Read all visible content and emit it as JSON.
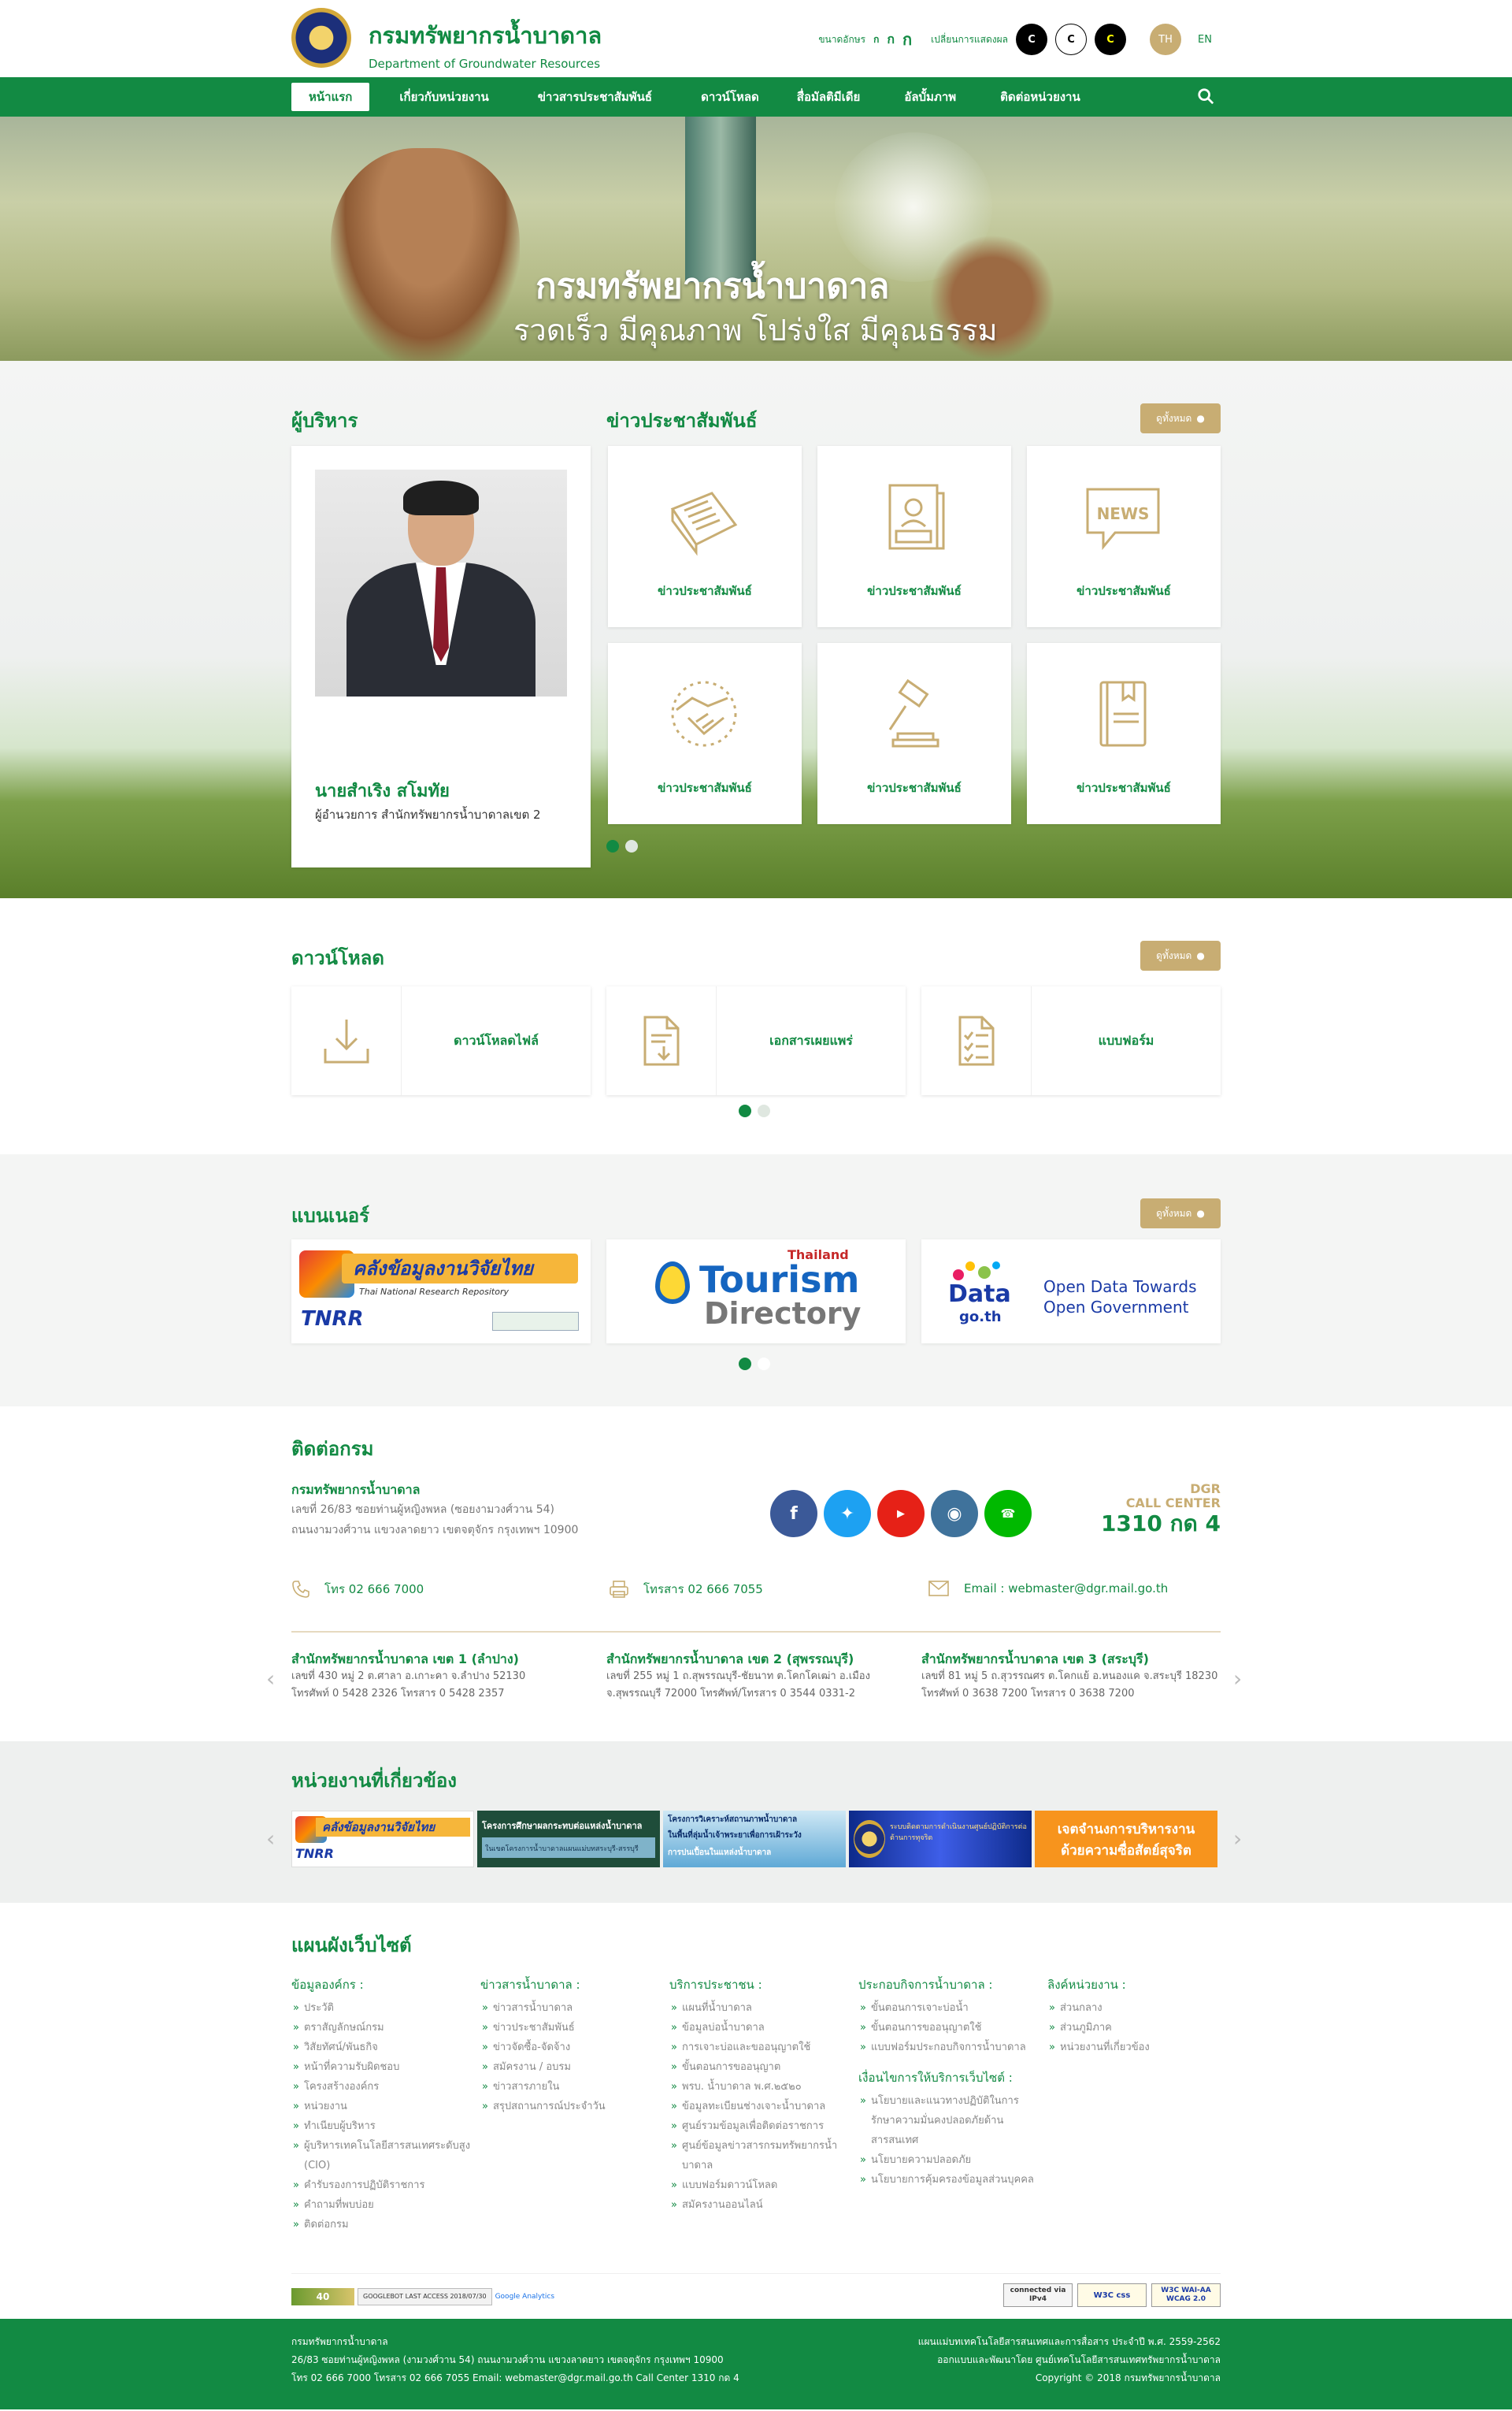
{
  "header": {
    "title_th": "กรมทรัพยากรน้ำบาดาล",
    "title_en": "Department of Groundwater Resources",
    "font_size_label": "ขนาดอักษร",
    "font_sizes": [
      "ก",
      "ก",
      "ก"
    ],
    "contrast_label": "เปลี่ยนการแสดงผล",
    "contrast_options": [
      "C",
      "C",
      "C"
    ],
    "lang_th": "TH",
    "lang_en": "EN"
  },
  "nav": {
    "items": [
      "หน้าแรก",
      "เกี่ยวกับหน่วยงาน",
      "ข่าวสารประชาสัมพันธ์",
      "ดาวน์โหลด",
      "สื่อมัลติมีเดีย",
      "อัลบั้มภาพ",
      "ติดต่อหน่วยงาน"
    ],
    "active_index": 0
  },
  "hero": {
    "title": "กรมทรัพยากรน้ำบาดาล",
    "slogan": "รวดเร็ว มีคุณภาพ โปร่งใส มีคุณธรรม"
  },
  "executives": {
    "heading": "ผู้บริหาร",
    "name": "นายสำเริง สโมทัย",
    "position": "ผู้อำนวยการ สำนักทรัพยากรน้ำบาดาลเขต 2"
  },
  "news": {
    "heading": "ข่าวประชาสัมพันธ์",
    "more_label": "ดูทั้งหมด",
    "cards": [
      {
        "label": "ข่าวประชาสัมพันธ์",
        "icon": "newspaper-icon"
      },
      {
        "label": "ข่าวประชาสัมพันธ์",
        "icon": "news-document-icon"
      },
      {
        "label": "ข่าวประชาสัมพันธ์",
        "icon": "today-news-icon"
      },
      {
        "label": "ข่าวประชาสัมพันธ์",
        "icon": "handshake-icon"
      },
      {
        "label": "ข่าวประชาสัมพันธ์",
        "icon": "gavel-icon"
      },
      {
        "label": "ข่าวประชาสัมพันธ์",
        "icon": "book-icon"
      }
    ]
  },
  "downloads": {
    "heading": "ดาวน์โหลด",
    "more_label": "ดูทั้งหมด",
    "items": [
      {
        "label": "ดาวน์โหลดไฟล์",
        "icon": "download-icon"
      },
      {
        "label": "เอกสารเผยแพร่",
        "icon": "document-download-icon"
      },
      {
        "label": "แบบฟอร์ม",
        "icon": "form-checklist-icon"
      }
    ]
  },
  "banners": {
    "heading": "แบนเนอร์",
    "more_label": "ดูทั้งหมด",
    "items": [
      {
        "text": "คลังข้อมูลงานวิจัยไทย",
        "sub": "Thai National Research Repository",
        "tag": "TNRR"
      },
      {
        "text_top": "Thailand",
        "text_main": "Tourism",
        "text_sub": "Directory"
      },
      {
        "logo": "Data",
        "logo_sub": "go.th",
        "text1": "Open Data Towards",
        "text2": "Open Government"
      }
    ]
  },
  "contact": {
    "heading": "ติดต่อกรม",
    "org": "กรมทรัพยากรน้ำบาดาล",
    "address1": "เลขที่ 26/83 ซอยท่านผู้หญิงพหล (ซอยงามวงศ์วาน 54)",
    "address2": "ถนนงามวงศ์วาน แขวงลาดยาว เขตจตุจักร กรุงเทพฯ 10900",
    "socials": [
      "facebook-icon",
      "twitter-icon",
      "youtube-icon",
      "instagram-icon",
      "line-icon"
    ],
    "callcenter_label1": "DGR",
    "callcenter_label2": "CALL CENTER",
    "callcenter_number": "1310 กด 4",
    "phone": "โทร 02 666 7000",
    "fax": "โทรสาร 02 666 7055",
    "email": "Email : webmaster@dgr.mail.go.th",
    "branches": [
      {
        "title": "สำนักทรัพยากรน้ำบาดาล เขต 1 (ลำปาง)",
        "line1": "เลขที่ 430 หมู่ 2 ต.ศาลา อ.เกาะคา จ.ลำปาง 52130",
        "line2": "โทรศัพท์ 0 5428 2326 โทรสาร 0 5428 2357"
      },
      {
        "title": "สำนักทรัพยากรน้ำบาดาล เขต 2 (สุพรรณบุรี)",
        "line1": "เลขที่ 255 หมู่ 1 ถ.สุพรรณบุรี-ชัยนาท ต.โคกโคเฒ่า อ.เมือง",
        "line2": "จ.สุพรรณบุรี 72000 โทรศัพท์/โทรสาร 0 3544 0331-2"
      },
      {
        "title": "สำนักทรัพยากรน้ำบาดาล เขต 3 (สระบุรี)",
        "line1": "เลขที่ 81 หมู่ 5 ถ.สุวรรณศร ต.โคกแย้ อ.หนองแค จ.สระบุรี 18230",
        "line2": "โทรศัพท์ 0 3638 7200 โทรสาร 0 3638 7200"
      }
    ]
  },
  "related": {
    "heading": "หน่วยงานที่เกี่ยวข้อง",
    "items": [
      {
        "text": "คลังข้อมูลงานวิจัยไทย",
        "tag": "TNRR"
      },
      {
        "text": "โครงการศึกษาผลกระทบต่อแหล่งน้ำบาดาล",
        "sub": "ในเขตโครงการน้ำบาดาลแผนแม่บทสระบุรี-สรรบุรี"
      },
      {
        "text": "โครงการวิเคราะห์สถานภาพน้ำบาดาล",
        "sub": "ในพื้นที่ลุ่มน้ำเจ้าพระยาเพื่อการเฝ้าระวัง",
        "sub2": "การปนเปื้อนในแหล่งน้ำบาดาล"
      },
      {
        "text": "ระบบติดตามการดำเนินงานศูนย์ปฏิบัติการต่อต้านการทุจริต"
      },
      {
        "text1": "เจตจำนงการบริหารงาน",
        "text2": "ด้วยความซื่อสัตย์สุจริต"
      }
    ]
  },
  "sitemap": {
    "heading": "แผนผังเว็บไซต์",
    "columns": [
      {
        "title": "ข้อมูลองค์กร :",
        "items": [
          "ประวัติ",
          "ตราสัญลักษณ์กรม",
          "วิสัยทัศน์/พันธกิจ",
          "หน้าที่ความรับผิดชอบ",
          "โครงสร้างองค์กร",
          "หน่วยงาน",
          "ทำเนียบผู้บริหาร",
          "ผู้บริหารเทคโนโลยีสารสนเทศระดับสูง (CIO)",
          "คำรับรองการปฏิบัติราชการ",
          "คำถามที่พบบ่อย",
          "ติดต่อกรม"
        ]
      },
      {
        "title": "ข่าวสารน้ำบาดาล :",
        "items": [
          "ข่าวสารน้ำบาดาล",
          "ข่าวประชาสัมพันธ์",
          "ข่าวจัดซื้อ-จัดจ้าง",
          "สมัครงาน / อบรม",
          "ข่าวสารภายใน",
          "สรุปสถานการณ์ประจำวัน"
        ]
      },
      {
        "title": "บริการประชาชน :",
        "items": [
          "แผนที่น้ำบาดาล",
          "ข้อมูลบ่อน้ำบาดาล",
          "การเจาะบ่อและขออนุญาตใช้",
          "ขั้นตอนการขออนุญาต",
          "พรบ. น้ำบาดาล พ.ศ.๒๕๒๐",
          "ข้อมูลทะเบียนช่างเจาะน้ำบาดาล",
          "ศูนย์รวมข้อมูลเพื่อติดต่อราชการ",
          "ศูนย์ข้อมูลข่าวสารกรมทรัพยากรน้ำบาดาล",
          "แบบฟอร์มดาวน์โหลด",
          "สมัครงานออนไลน์"
        ]
      },
      {
        "title": "ประกอบกิจการน้ำบาดาล :",
        "items": [
          "ขั้นตอนการเจาะบ่อน้ำ",
          "ขั้นตอนการขออนุญาตใช้",
          "แบบฟอร์มประกอบกิจการน้ำบาดาล"
        ],
        "title2": "เงื่อนไขการให้บริการเว็บไซต์ :",
        "items2": [
          "นโยบายและแนวทางปฏิบัติในการรักษาความมั่นคงปลอดภัยด้านสารสนเทศ",
          "นโยบายความปลอดภัย",
          "นโยบายการคุ้มครองข้อมูลส่วนบุคคล"
        ]
      },
      {
        "title": "ลิงค์หน่วยงาน :",
        "items": [
          "ส่วนกลาง",
          "ส่วนภูมิภาค",
          "หน่วยงานที่เกี่ยวข้อง"
        ]
      }
    ],
    "badges_left": [
      "40",
      "GOOGLEBOT LAST ACCESS 2018/07/30",
      "Google Analytics"
    ],
    "badges_right": [
      "connected via IPv4",
      "W3C css",
      "W3C WAI-AA WCAG 2.0"
    ]
  },
  "footer": {
    "l1": "กรมทรัพยากรน้ำบาดาล",
    "l2": "26/83 ซอยท่านผู้หญิงพหล (งามวงศ์วาน 54) ถนนงามวงศ์วาน แขวงลาดยาว เขตจตุจักร กรุงเทพฯ 10900",
    "l3": "โทร 02 666 7000 โทรสาร 02 666 7055 Email: webmaster@dgr.mail.go.th Call Center 1310 กด 4",
    "r1": "แผนแม่บทเทคโนโลยีสารสนเทศและการสื่อสาร ประจำปี พ.ศ. 2559-2562",
    "r2": "ออกแบบและพัฒนาโดย ศูนย์เทคโนโลยีสารสนเทศทรัพยากรน้ำบาดาล",
    "r3": "Copyright © 2018 กรมทรัพยากรน้ำบาดาล"
  },
  "colors": {
    "primary": "#128a43",
    "gold": "#c8ad73"
  }
}
